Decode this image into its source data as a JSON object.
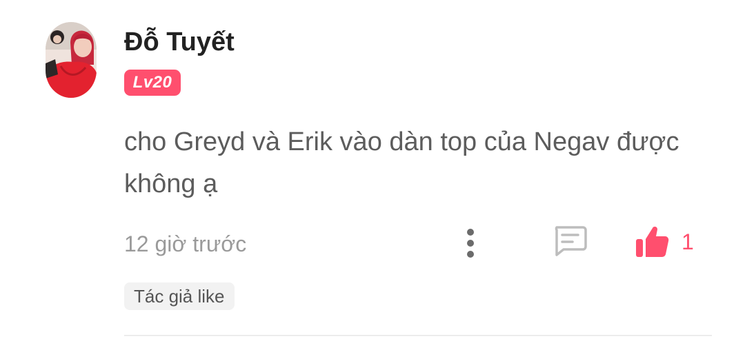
{
  "comment": {
    "author": {
      "name": "Đỗ Tuyết",
      "level": "Lv20",
      "avatar": "user-avatar-photo"
    },
    "text": "cho Greyd và Erik vào dàn top của Negav được không ạ",
    "timestamp": "12 giờ trước",
    "actions": {
      "more_icon": "more-vertical-icon",
      "reply_icon": "comment-bubble-icon",
      "like_icon": "thumbs-up-icon",
      "like_count": "1"
    },
    "author_like_label": "Tác giả like"
  },
  "colors": {
    "accent": "#ff4f6e",
    "text_primary": "#222222",
    "text_body": "#5c5c5c",
    "text_muted": "#9a9a9a",
    "tag_background": "#f2f2f2"
  }
}
